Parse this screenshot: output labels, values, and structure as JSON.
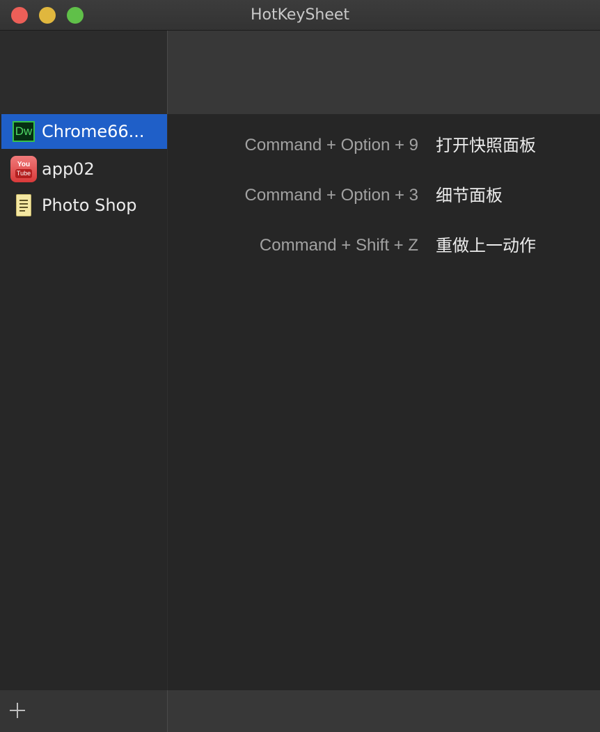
{
  "window": {
    "title": "HotKeySheet"
  },
  "sidebar": {
    "items": [
      {
        "label": "Chrome66...",
        "icon": "dreamweaver-icon",
        "icon_text": "Dw",
        "selected": true
      },
      {
        "label": "app02",
        "icon": "youtube-icon",
        "icon_text_top": "You",
        "icon_text_bottom": "Tube",
        "selected": false
      },
      {
        "label": "Photo Shop",
        "icon": "note-icon",
        "selected": false
      }
    ],
    "add_button_icon": "plus-icon"
  },
  "hotkeys": [
    {
      "keys": "Command + Option + 9",
      "description": "打开快照面板"
    },
    {
      "keys": "Command + Option + 3",
      "description": "细节面板"
    },
    {
      "keys": "Command + Shift + Z",
      "description": "重做上一动作"
    }
  ],
  "colors": {
    "selection": "#1f5fc8",
    "background": "#262626",
    "close": "#ec5f58",
    "minimize": "#e0b73e",
    "maximize": "#60c049"
  }
}
